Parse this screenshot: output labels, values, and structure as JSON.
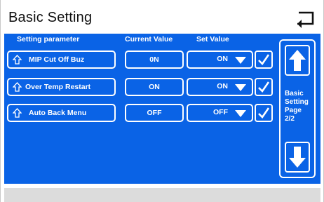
{
  "title": "Basic Setting",
  "headers": {
    "parameter": "Setting parameter",
    "current": "Current Value",
    "set": "Set Value"
  },
  "rows": [
    {
      "label": "MIP Cut Off Buz",
      "current": "0N",
      "set": "ON"
    },
    {
      "label": "Over Temp Restart",
      "current": "ON",
      "set": "ON"
    },
    {
      "label": "Auto Back Menu",
      "current": "OFF",
      "set": "OFF"
    }
  ],
  "side_panel": {
    "line1": "Basic",
    "line2": "Setting",
    "line3": "Page",
    "line4": "2/2"
  },
  "colors": {
    "panel": "#0a63e6",
    "foreground": "#ffffff",
    "bottom_bar": "#dcdcdc"
  },
  "icons": {
    "back": "return-arrow-icon",
    "parameter": "diamond-arrow-icon",
    "dropdown": "triangle-down-icon",
    "confirm": "checkmark-icon",
    "page_up": "arrow-up-icon",
    "page_down": "arrow-down-icon"
  }
}
